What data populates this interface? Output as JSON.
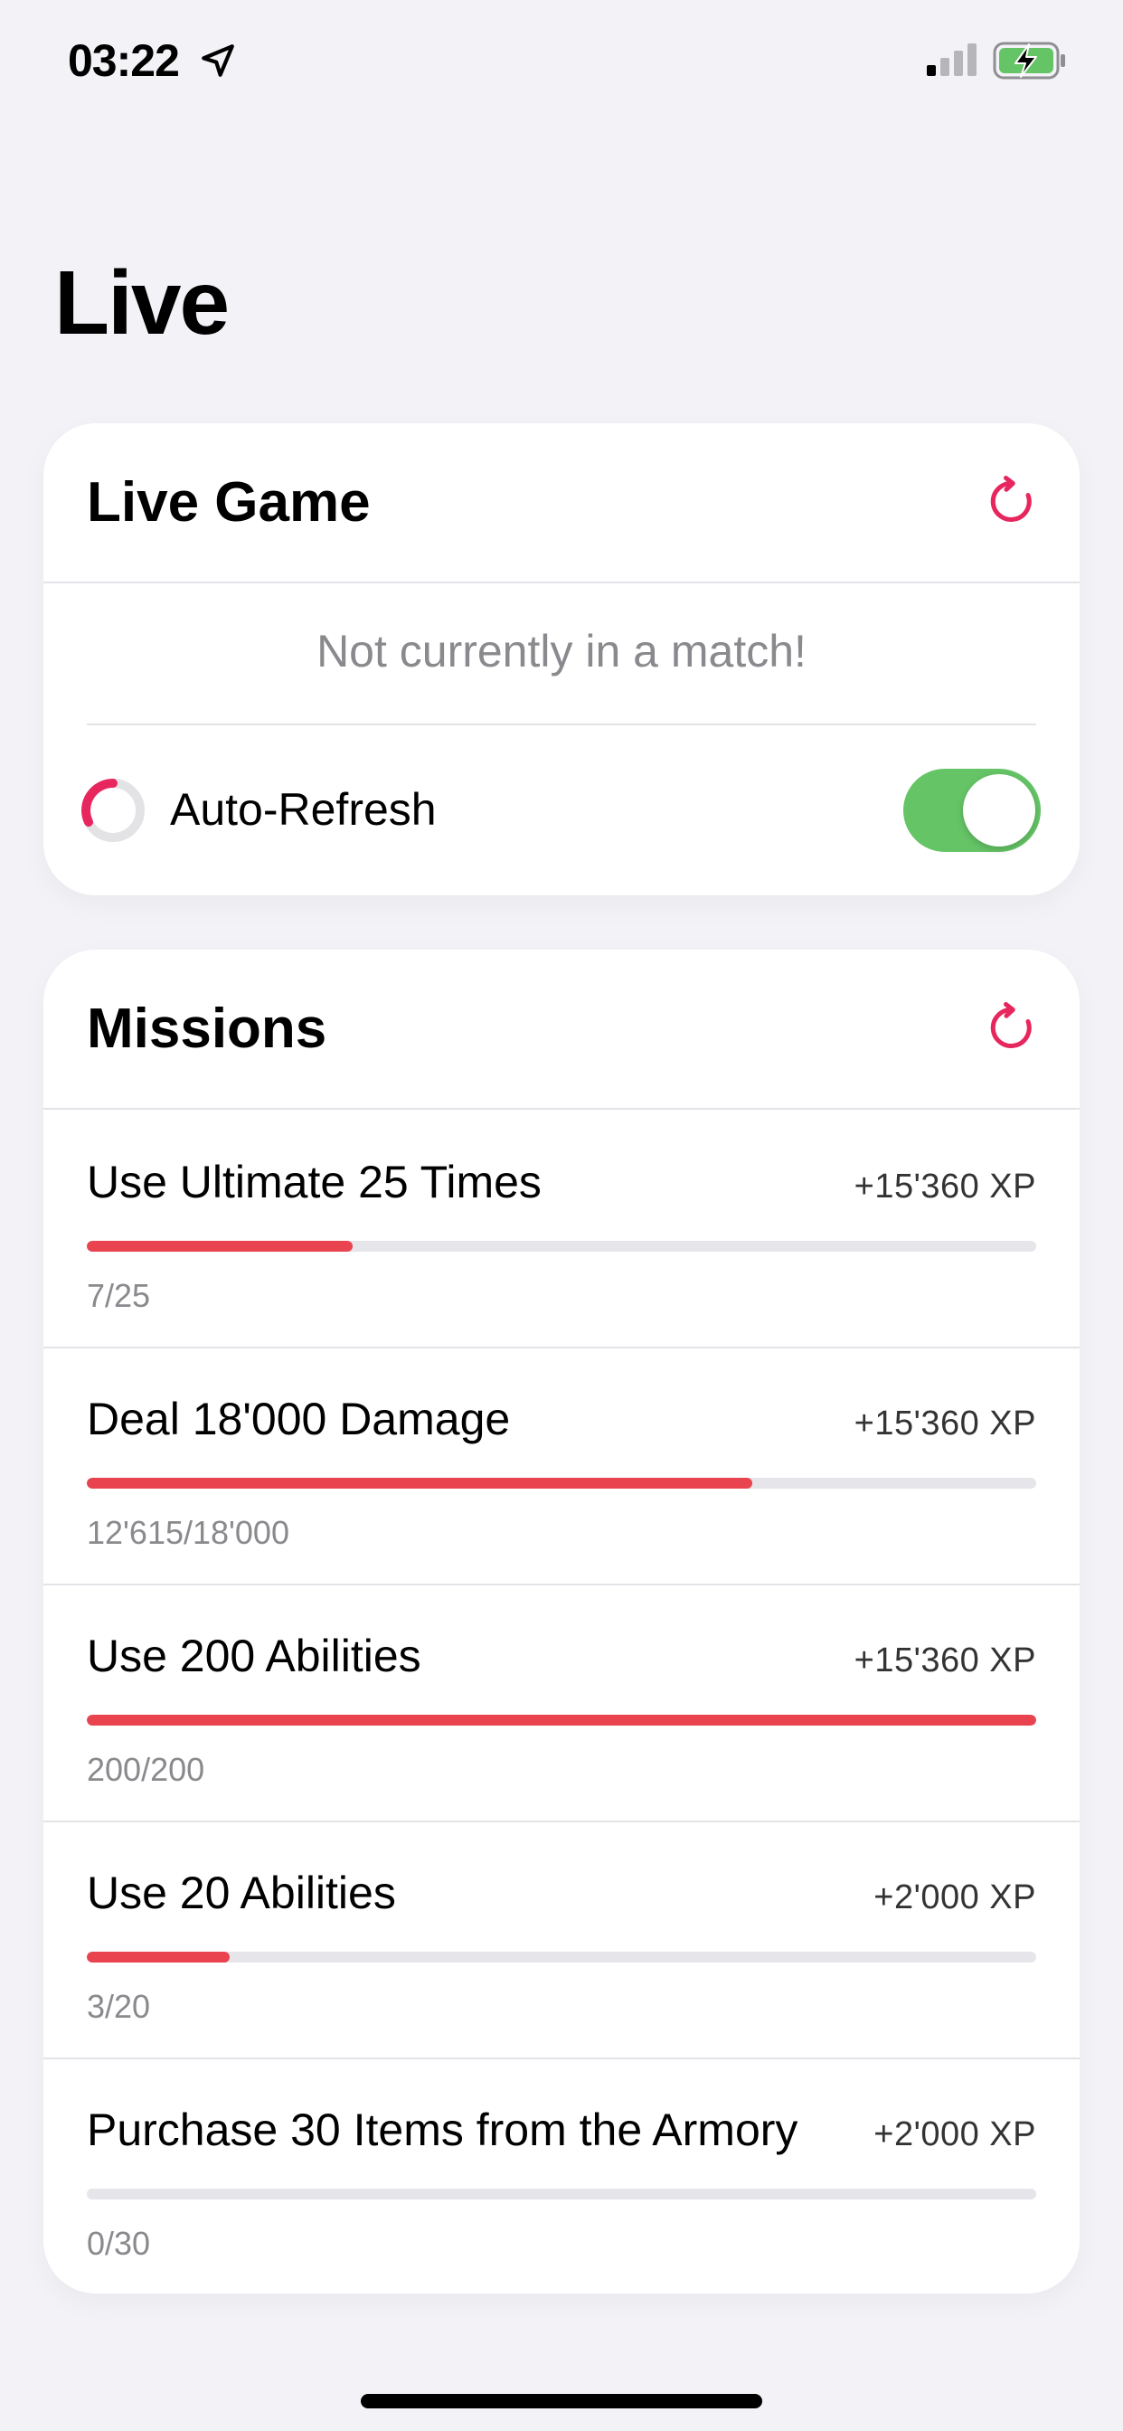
{
  "status_bar": {
    "time": "03:22",
    "icons": [
      "location-arrow-icon",
      "signal-icon",
      "battery-charging-icon"
    ]
  },
  "page": {
    "title": "Live"
  },
  "live_game": {
    "title": "Live Game",
    "refresh_icon": "refresh-icon",
    "message": "Not currently in a match!",
    "auto_refresh": {
      "label": "Auto-Refresh",
      "enabled": true
    }
  },
  "missions": {
    "title": "Missions",
    "refresh_icon": "refresh-icon",
    "items": [
      {
        "name": "Use Ultimate 25 Times",
        "xp": "+15'360 XP",
        "progress_text": "7/25",
        "progress": 0.28
      },
      {
        "name": "Deal 18'000 Damage",
        "xp": "+15'360 XP",
        "progress_text": "12'615/18'000",
        "progress": 0.7008
      },
      {
        "name": "Use 200 Abilities",
        "xp": "+15'360 XP",
        "progress_text": "200/200",
        "progress": 1.0
      },
      {
        "name": "Use 20 Abilities",
        "xp": "+2'000 XP",
        "progress_text": "3/20",
        "progress": 0.15
      },
      {
        "name": "Purchase 30 Items from the Armory",
        "xp": "+2'000 XP",
        "progress_text": "0/30",
        "progress": 0.0
      }
    ]
  },
  "colors": {
    "accent": "#e8434f",
    "toggle_on": "#65c466",
    "battery": "#65c466"
  }
}
